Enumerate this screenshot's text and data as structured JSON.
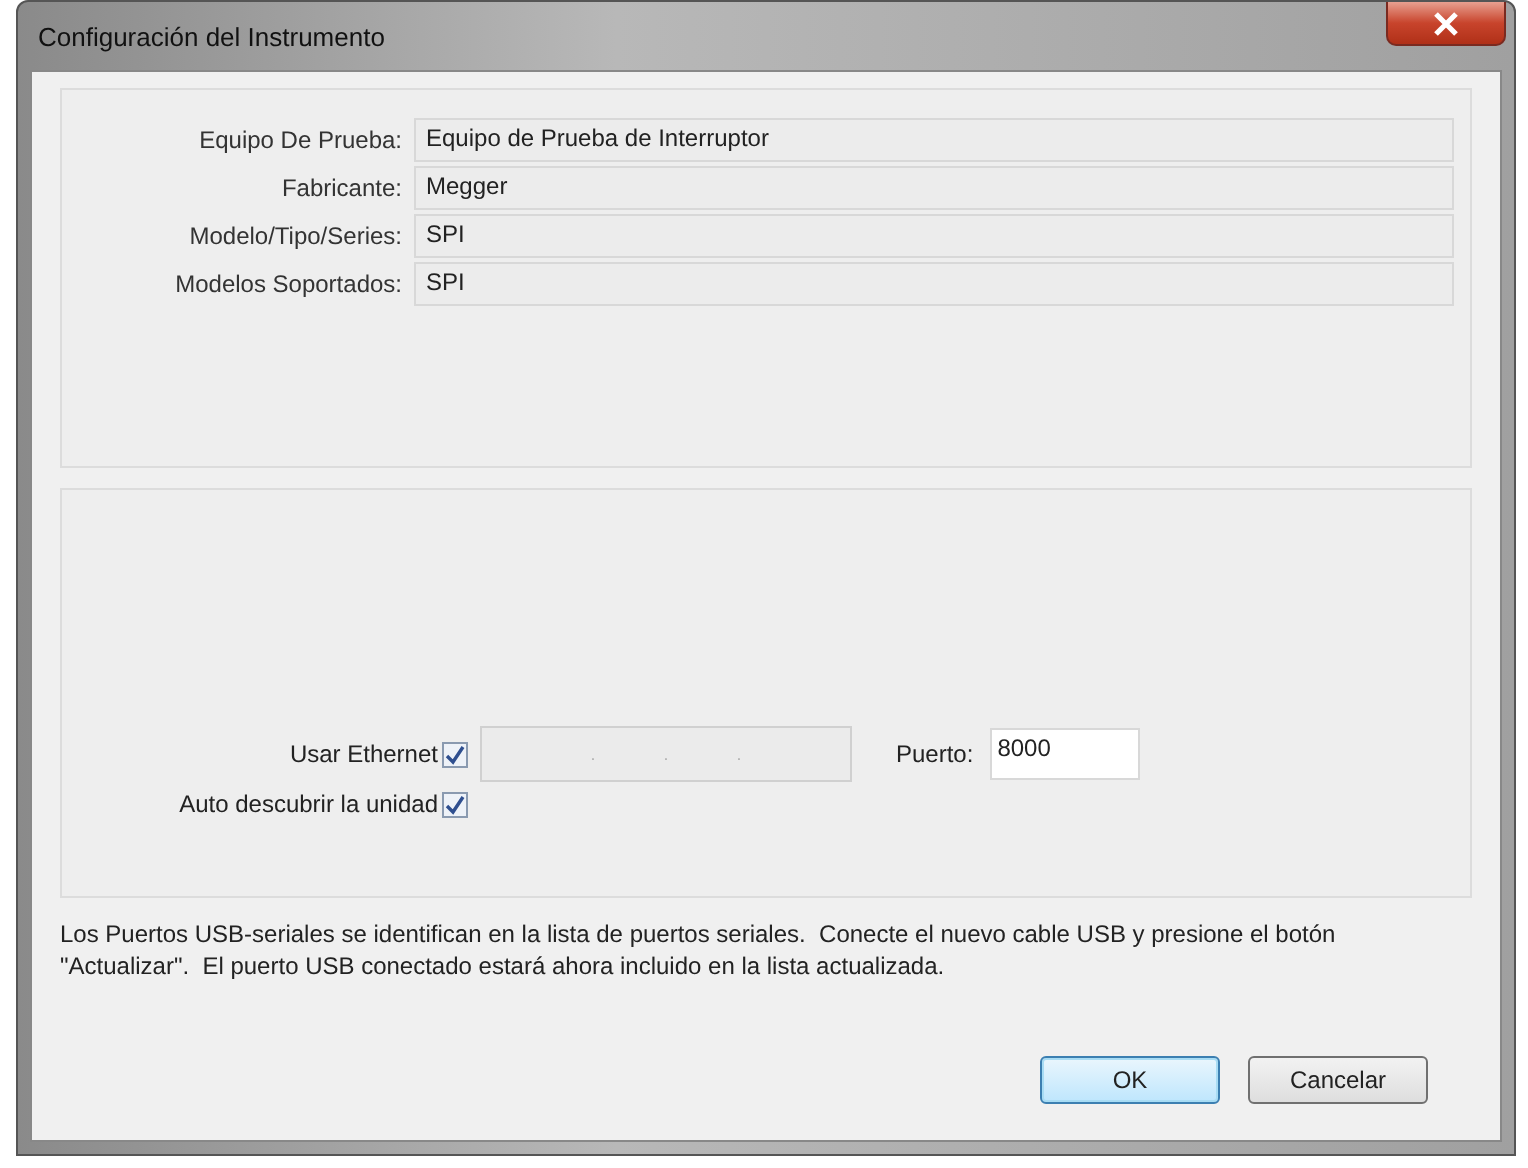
{
  "window": {
    "title": "Configuración del Instrumento"
  },
  "info_fields": [
    {
      "label": "Equipo De Prueba:",
      "value": "Equipo de Prueba de Interruptor"
    },
    {
      "label": "Fabricante:",
      "value": "Megger"
    },
    {
      "label": "Modelo/Tipo/Series:",
      "value": "SPI"
    },
    {
      "label": "Modelos Soportados:",
      "value": "SPI"
    }
  ],
  "ethernet": {
    "label": "Usar Ethernet",
    "checked": true,
    "ip_field": {
      "disabled": true,
      "separators": [
        ".",
        ".",
        "."
      ]
    },
    "port_label": "Puerto:",
    "port_value": "8000"
  },
  "auto_discover": {
    "label": "Auto descubrir la unidad",
    "checked": true
  },
  "note": "Los Puertos USB-seriales se identifican en la lista de puertos seriales.  Conecte el nuevo cable USB y presione el botón \"Actualizar\".  El puerto USB conectado estará ahora incluido en la lista actualizada.",
  "buttons": [
    {
      "label": "OK",
      "default": true
    },
    {
      "label": "Cancelar",
      "default": false
    }
  ]
}
